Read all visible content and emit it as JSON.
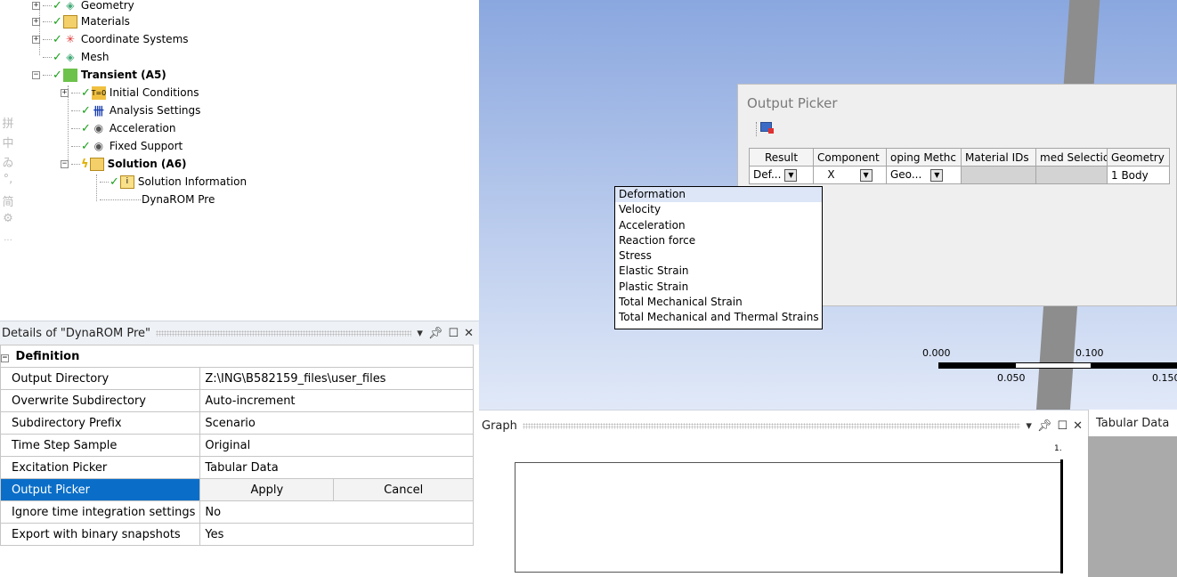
{
  "tree": {
    "items": [
      {
        "label": "Geometry",
        "bold": false
      },
      {
        "label": "Materials",
        "bold": false
      },
      {
        "label": "Coordinate Systems",
        "bold": false
      },
      {
        "label": "Mesh",
        "bold": false
      },
      {
        "label": "Transient (A5)",
        "bold": true
      },
      {
        "label": "Initial Conditions",
        "bold": false
      },
      {
        "label": "Analysis Settings",
        "bold": false
      },
      {
        "label": "Acceleration",
        "bold": false
      },
      {
        "label": "Fixed Support",
        "bold": false
      },
      {
        "label": "Solution (A6)",
        "bold": true
      },
      {
        "label": "Solution Information",
        "bold": false
      },
      {
        "label": "DynaROM Pre",
        "bold": false
      }
    ],
    "ime_glyphs": [
      "拼",
      "中",
      "ゐ",
      "°,",
      "简",
      "⚙",
      "..."
    ]
  },
  "details": {
    "title": "Details of \"DynaROM Pre\"",
    "section": "Definition",
    "rows": [
      {
        "key": "Output Directory",
        "value": "Z:\\ING\\B582159_files\\user_files"
      },
      {
        "key": "Overwrite Subdirectory",
        "value": "Auto-increment"
      },
      {
        "key": "Subdirectory Prefix",
        "value": "Scenario"
      },
      {
        "key": "Time Step Sample",
        "value": "Original"
      },
      {
        "key": "Excitation Picker",
        "value": "Tabular Data"
      },
      {
        "key": "Output Picker",
        "apply": "Apply",
        "cancel": "Cancel"
      },
      {
        "key": "Ignore time integration settings",
        "value": "No"
      },
      {
        "key": "Export with binary snapshots",
        "value": "Yes"
      }
    ]
  },
  "viewport": {
    "scale": {
      "t0": "0.000",
      "t1": "0.100",
      "b1": "0.050",
      "b2": "0.150"
    }
  },
  "graph": {
    "title": "Graph",
    "axis_label": "1."
  },
  "tabular": {
    "title": "Tabular Data"
  },
  "picker": {
    "title": "Output Picker",
    "headers": [
      "Result",
      "Component",
      "oping Methc",
      "Material IDs",
      "med Selectic",
      "Geometry"
    ],
    "row": {
      "result": "Def...",
      "component": "X",
      "scoping": "Geo...",
      "material": "",
      "named": "",
      "geometry": "1 Body"
    },
    "options": [
      "Deformation",
      "Velocity",
      "Acceleration",
      "Reaction force",
      "Stress",
      "Elastic Strain",
      "Plastic Strain",
      "Total Mechanical Strain",
      "Total Mechanical and Thermal Strains"
    ]
  },
  "colors": {
    "selection": "#0a6ec8",
    "check": "#1aa01a",
    "viewport_top": "#8aa7df"
  }
}
